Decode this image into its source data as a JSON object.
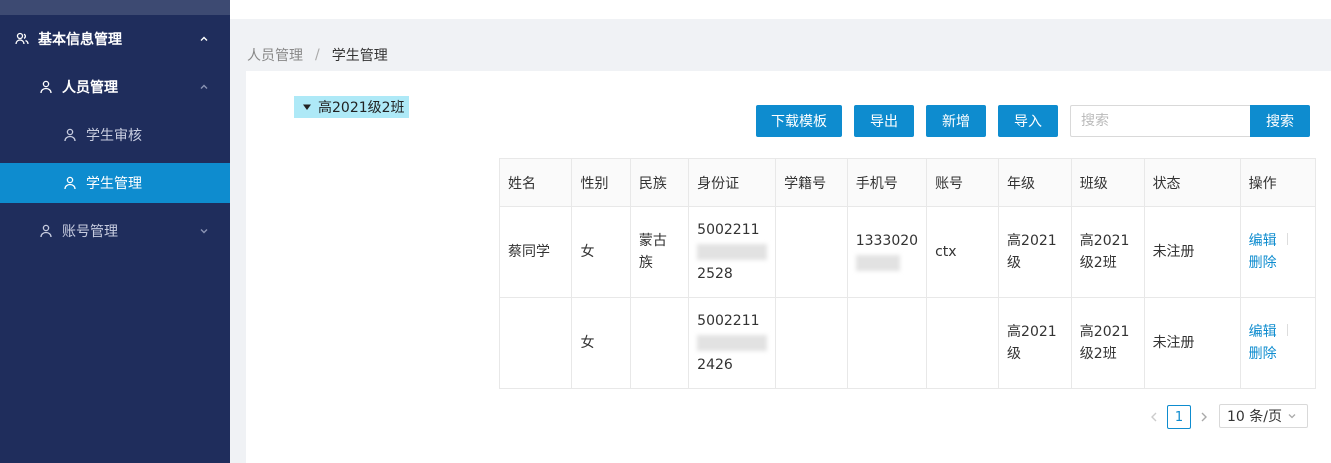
{
  "sidebar": {
    "items": [
      {
        "label": "基本信息管理",
        "icon": "users-icon",
        "expanded": true
      },
      {
        "label": "人员管理",
        "icon": "user-icon",
        "expanded": true
      },
      {
        "label": "学生审核",
        "icon": "user-icon"
      },
      {
        "label": "学生管理",
        "icon": "user-icon",
        "active": true
      },
      {
        "label": "账号管理",
        "icon": "user-icon",
        "expanded": false
      }
    ]
  },
  "breadcrumb": {
    "items": [
      "人员管理",
      "学生管理"
    ],
    "separator": "/"
  },
  "tree": {
    "node_label": "高2021级2班"
  },
  "toolbar": {
    "download_template": "下载模板",
    "export": "导出",
    "add": "新增",
    "import": "导入",
    "search_placeholder": "搜索",
    "search_button": "搜索"
  },
  "table": {
    "columns": [
      "姓名",
      "性别",
      "民族",
      "身份证",
      "学籍号",
      "手机号",
      "账号",
      "年级",
      "班级",
      "状态",
      "操作"
    ],
    "rows": [
      {
        "name": "蔡同学",
        "gender": "女",
        "ethnicity": "蒙古族",
        "id_prefix": "5002211",
        "id_suffix": "2528",
        "student_no": "",
        "phone_prefix": "1333020",
        "account": "ctx",
        "grade_line1": "高2021",
        "grade_line2": "级",
        "class_line1": "高2021",
        "class_line2": "级2班",
        "status": "未注册",
        "edit": "编辑",
        "delete": "删除"
      },
      {
        "name": "",
        "gender": "女",
        "ethnicity": "",
        "id_prefix": "5002211",
        "id_suffix": "2426",
        "student_no": "",
        "phone_prefix": "",
        "account": "",
        "grade_line1": "高2021",
        "grade_line2": "级",
        "class_line1": "高2021",
        "class_line2": "级2班",
        "status": "未注册",
        "edit": "编辑",
        "delete": "删除"
      }
    ]
  },
  "pagination": {
    "current_page": "1",
    "page_size": "10 条/页"
  },
  "colors": {
    "sidebar_bg": "#1f2d5c",
    "accent": "#0e8ccf",
    "tree_highlight": "#aee9f7"
  }
}
